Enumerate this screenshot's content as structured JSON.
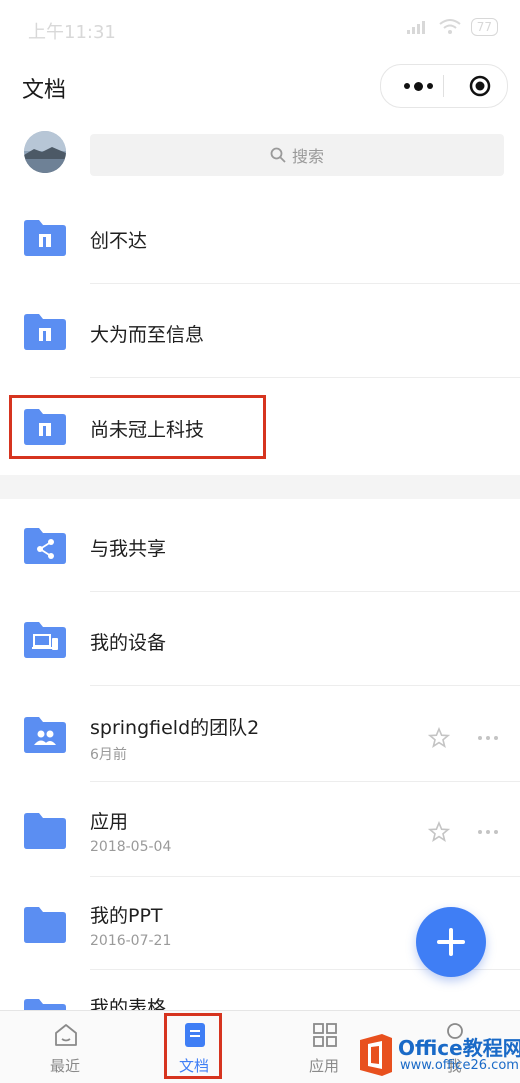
{
  "status": {
    "time": "上午11:31",
    "battery": "77"
  },
  "header": {
    "title": "文档"
  },
  "search": {
    "placeholder": "搜索"
  },
  "folders_top": [
    {
      "name": "创不达",
      "icon": "team-folder-icon"
    },
    {
      "name": "大为而至信息",
      "icon": "team-folder-icon"
    },
    {
      "name": "尚未冠上科技",
      "icon": "team-folder-icon"
    }
  ],
  "folders_bottom": [
    {
      "name": "与我共享",
      "icon": "shared-folder-icon"
    },
    {
      "name": "我的设备",
      "icon": "device-folder-icon"
    },
    {
      "name": "springfield的团队2",
      "sub": "6月前",
      "icon": "group-folder-icon"
    },
    {
      "name": "应用",
      "sub": "2018-05-04",
      "icon": "folder-icon"
    },
    {
      "name": "我的PPT",
      "sub": "2016-07-21",
      "icon": "folder-icon"
    },
    {
      "name": "我的表格",
      "icon": "folder-icon"
    }
  ],
  "tabs": [
    {
      "label": "最近",
      "icon": "home-icon"
    },
    {
      "label": "文档",
      "icon": "document-icon",
      "active": true
    },
    {
      "label": "应用",
      "icon": "apps-grid-icon"
    },
    {
      "label": "我",
      "icon": "user-icon"
    }
  ],
  "watermark": {
    "line1": "Office教程网",
    "line2": "www.office26.com"
  },
  "colors": {
    "accent": "#3f7ef5",
    "folder": "#5b8ef2",
    "highlight": "#d6341f"
  }
}
